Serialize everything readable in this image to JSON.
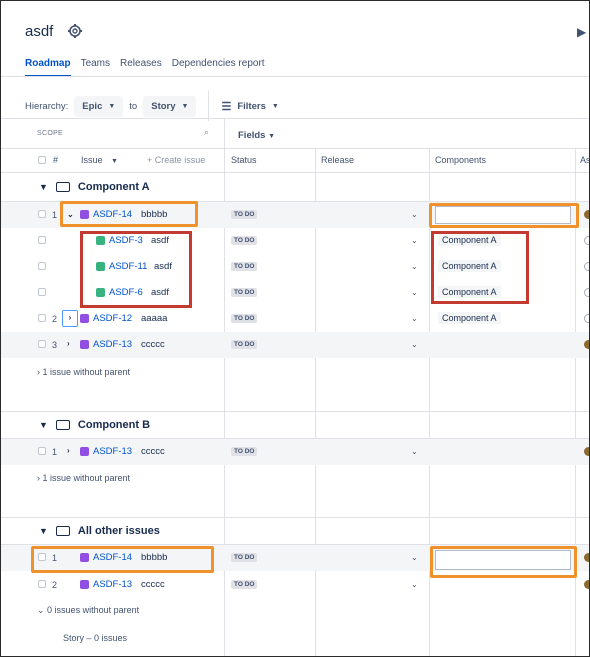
{
  "project": {
    "title": "asdf"
  },
  "tabs": [
    {
      "label": "Roadmap",
      "active": true
    },
    {
      "label": "Teams",
      "active": false
    },
    {
      "label": "Releases",
      "active": false
    },
    {
      "label": "Dependencies report",
      "active": false
    }
  ],
  "hierarchy": {
    "label": "Hierarchy:",
    "from": "Epic",
    "to_label": "to",
    "to": "Story"
  },
  "filters_label": "Filters",
  "scope_label": "SCOPE",
  "fields_label": "Fields",
  "columns": {
    "number": "#",
    "issue": "Issue",
    "create_issue": "+ Create issue",
    "status": "Status",
    "release": "Release",
    "components": "Components",
    "assignee": "As"
  },
  "groups": [
    {
      "name": "Component A",
      "rows": [
        {
          "num": "1",
          "expander": "open",
          "type": "epic",
          "key": "ASDF-14",
          "summary": "bbbbb",
          "status": "TO DO",
          "component": "",
          "assignee": "filled"
        },
        {
          "num": "",
          "expander": "",
          "type": "story",
          "key": "ASDF-3",
          "summary": "asdf",
          "status": "TO DO",
          "component": "Component A",
          "assignee": "empty"
        },
        {
          "num": "",
          "expander": "",
          "type": "story",
          "key": "ASDF-11",
          "summary": "asdf",
          "status": "TO DO",
          "component": "Component A",
          "assignee": "empty"
        },
        {
          "num": "",
          "expander": "",
          "type": "story",
          "key": "ASDF-6",
          "summary": "asdf",
          "status": "TO DO",
          "component": "Component A",
          "assignee": "empty"
        },
        {
          "num": "2",
          "expander": "closed",
          "type": "epic",
          "key": "ASDF-12",
          "summary": "aaaaa",
          "status": "TO DO",
          "component": "Component A",
          "assignee": "empty"
        },
        {
          "num": "3",
          "expander": "closed",
          "type": "epic",
          "key": "ASDF-13",
          "summary": "ccccc",
          "status": "TO DO",
          "component": "",
          "assignee": "filled"
        }
      ],
      "without_parent": "1 issue without parent"
    },
    {
      "name": "Component B",
      "rows": [
        {
          "num": "1",
          "expander": "closed",
          "type": "epic",
          "key": "ASDF-13",
          "summary": "ccccc",
          "status": "TO DO",
          "component": "",
          "assignee": "filled"
        }
      ],
      "without_parent": "1 issue without parent"
    },
    {
      "name": "All other issues",
      "rows": [
        {
          "num": "1",
          "expander": "",
          "type": "epic",
          "key": "ASDF-14",
          "summary": "bbbbb",
          "status": "TO DO",
          "component": "",
          "assignee": "filled"
        },
        {
          "num": "2",
          "expander": "",
          "type": "epic",
          "key": "ASDF-13",
          "summary": "ccccc",
          "status": "TO DO",
          "component": "",
          "assignee": "filled"
        }
      ],
      "without_parent": "0 issues without parent",
      "story_count": "Story – 0 issues"
    }
  ],
  "colors": {
    "accent": "#0052cc",
    "epic": "#904ee2",
    "story": "#36b37e",
    "highlight_orange": "#f0922b",
    "highlight_red": "#c33a30"
  }
}
